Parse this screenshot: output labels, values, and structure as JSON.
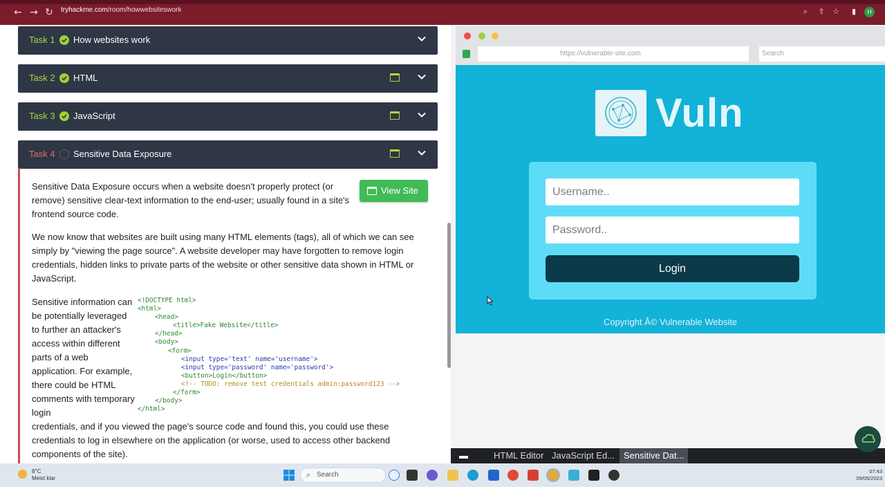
{
  "browser": {
    "url_host": "tryhackme.com",
    "url_path": "/room/howwebsiteswork",
    "avatar_letter": "H",
    "theme_color": "#7a1c2a"
  },
  "tasks": [
    {
      "num": "Task 1",
      "title": "How websites work",
      "status": "complete"
    },
    {
      "num": "Task 2",
      "title": "HTML",
      "status": "complete"
    },
    {
      "num": "Task 3",
      "title": "JavaScript",
      "status": "complete"
    },
    {
      "num": "Task 4",
      "title": "Sensitive Data Exposure",
      "status": "incomplete"
    }
  ],
  "task4": {
    "view_site_label": "View Site",
    "para1": "Sensitive Data Exposure occurs when a website doesn't properly protect (or remove) sensitive clear-text information to the end-user; usually found in a site's frontend source code.",
    "para2": "We now know that websites are built using many HTML elements (tags), all of which we can see simply by \"viewing the page source\". A website developer may have forgotten to remove login credentials, hidden links to private parts of the website or other sensitive data shown in HTML or JavaScript.",
    "para3": "Sensitive information can be potentially leveraged to further an attacker's access within different parts of a web application. For example, there could be HTML comments with temporary login",
    "para4": "credentials, and if you viewed the page's source code and found this, you could use these credentials to log in elsewhere on the application (or worse, used to access other backend components of the site).",
    "code_lines": [
      "<!DOCTYPE html>",
      "<html>",
      "<head>",
      "<title>Fake Website</title>",
      "</head>",
      "<body>",
      "<form>",
      "<input type='text' name='username'>",
      "<input type='password' name='password'>",
      "<button>Login</button>",
      "<!-- TODO: remove test credentials admin:password123 -->",
      "</form>",
      "</body>",
      "</html>"
    ]
  },
  "sim": {
    "address": "https://vulnerable-site.com",
    "search_placeholder": "Search",
    "brand": "Vuln",
    "username_placeholder": "Username..",
    "password_placeholder": "Password..",
    "login_label": "Login",
    "copyright": "Copyright Â© Vulnerable Website",
    "bg_color": "#13b2d8"
  },
  "editor_tabs": [
    "HTML Editor",
    "JavaScript Ed...",
    "Sensitive Dat..."
  ],
  "taskbar": {
    "temp": "8°C",
    "weather": "Meist klar",
    "search": "Search",
    "time": "07:43",
    "date": "09/05/2023"
  }
}
